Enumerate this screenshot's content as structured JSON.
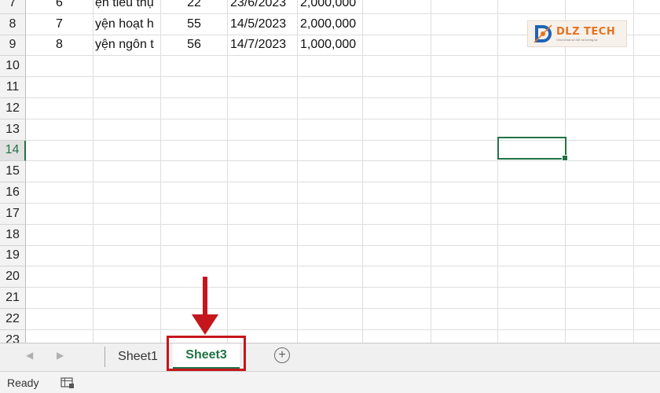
{
  "grid": {
    "rows": [
      {
        "num": "7",
        "cells": [
          "6",
          "ện tiêu thụ",
          "22",
          "23/6/2023",
          "2,000,000"
        ]
      },
      {
        "num": "8",
        "cells": [
          "7",
          "yện hoạt h",
          "55",
          "14/5/2023",
          "2,000,000"
        ]
      },
      {
        "num": "9",
        "cells": [
          "8",
          "yện ngôn t",
          "56",
          "14/7/2023",
          "1,000,000"
        ]
      },
      {
        "num": "10",
        "cells": [
          "",
          "",
          "",
          "",
          ""
        ]
      },
      {
        "num": "11",
        "cells": [
          "",
          "",
          "",
          "",
          ""
        ]
      },
      {
        "num": "12",
        "cells": [
          "",
          "",
          "",
          "",
          ""
        ]
      },
      {
        "num": "13",
        "cells": [
          "",
          "",
          "",
          "",
          ""
        ]
      },
      {
        "num": "14",
        "cells": [
          "",
          "",
          "",
          "",
          ""
        ]
      },
      {
        "num": "15",
        "cells": [
          "",
          "",
          "",
          "",
          ""
        ]
      },
      {
        "num": "16",
        "cells": [
          "",
          "",
          "",
          "",
          ""
        ]
      },
      {
        "num": "17",
        "cells": [
          "",
          "",
          "",
          "",
          ""
        ]
      },
      {
        "num": "18",
        "cells": [
          "",
          "",
          "",
          "",
          ""
        ]
      },
      {
        "num": "19",
        "cells": [
          "",
          "",
          "",
          "",
          ""
        ]
      },
      {
        "num": "20",
        "cells": [
          "",
          "",
          "",
          "",
          ""
        ]
      },
      {
        "num": "21",
        "cells": [
          "",
          "",
          "",
          "",
          ""
        ]
      },
      {
        "num": "22",
        "cells": [
          "",
          "",
          "",
          "",
          ""
        ]
      },
      {
        "num": "23",
        "cells": [
          "",
          "",
          "",
          "",
          ""
        ]
      }
    ],
    "active_row": "14"
  },
  "logo": {
    "brand": "DLZ TECH",
    "tagline": "Chìa khóa số mở ra tương lai",
    "icon": "dlz-tech-logo"
  },
  "tabs": {
    "nav_prev_icon": "triangle-left-icon",
    "nav_next_icon": "triangle-right-icon",
    "items": [
      {
        "label": "Sheet1",
        "active": false
      },
      {
        "label": "Sheet3",
        "active": true
      }
    ],
    "add_icon": "plus-circle-icon",
    "accent": "#217346",
    "highlight_color": "#c4161c"
  },
  "status": {
    "text": "Ready",
    "icon": "macro-recording-icon"
  }
}
